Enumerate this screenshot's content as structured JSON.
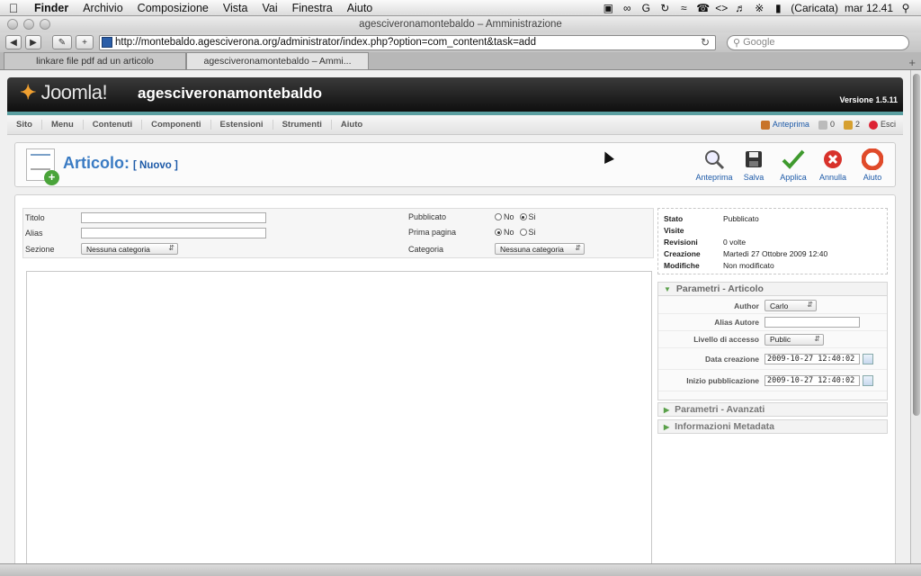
{
  "mac_menubar": {
    "apple": "",
    "items": [
      "Finder",
      "Archivio",
      "Composizione",
      "Vista",
      "Vai",
      "Finestra",
      "Aiuto"
    ],
    "status_icons": [
      "cs-icon",
      "sync-icon",
      "wifi-icon",
      "phone-icon",
      "code-icon",
      "volume-icon",
      "bluetooth-icon"
    ],
    "battery_text": "(Caricata)",
    "clock": "mar 12.41"
  },
  "window": {
    "title": "agesciveronamontebaldo – Amministrazione"
  },
  "browser": {
    "url": "http://montebaldo.agesciverona.org/administrator/index.php?option=com_content&task=add",
    "search_placeholder": "Google",
    "tabs": [
      {
        "label": "linkare file pdf ad un articolo"
      },
      {
        "label": "agesciveronamontebaldo – Ammi..."
      }
    ]
  },
  "joomla": {
    "logo_text": "Joomla!",
    "site_name": "agesciveronamontebaldo",
    "version": "Versione 1.5.11",
    "menu": [
      "Sito",
      "Menu",
      "Contenuti",
      "Componenti",
      "Estensioni",
      "Strumenti",
      "Aiuto"
    ],
    "menu_right": {
      "preview": "Anteprima",
      "messages_count": "0",
      "users_count": "2",
      "logout": "Esci"
    }
  },
  "toolbar": {
    "title": "Articolo:",
    "subtitle": "[ Nuovo ]",
    "buttons": [
      {
        "label": "Anteprima",
        "icon": "preview-icon"
      },
      {
        "label": "Salva",
        "icon": "save-icon"
      },
      {
        "label": "Applica",
        "icon": "apply-icon"
      },
      {
        "label": "Annulla",
        "icon": "cancel-icon"
      },
      {
        "label": "Aiuto",
        "icon": "help-icon"
      }
    ]
  },
  "form": {
    "title_label": "Titolo",
    "title_value": "",
    "alias_label": "Alias",
    "alias_value": "",
    "section_label": "Sezione",
    "section_value": "Nessuna categoria",
    "published_label": "Pubblicato",
    "published_no": "No",
    "published_yes": "Si",
    "published_selected": "Si",
    "frontpage_label": "Prima pagina",
    "frontpage_no": "No",
    "frontpage_yes": "Si",
    "frontpage_selected": "No",
    "category_label": "Categoria",
    "category_value": "Nessuna categoria"
  },
  "info": {
    "rows": [
      {
        "k": "Stato",
        "v": "Pubblicato"
      },
      {
        "k": "Visite",
        "v": ""
      },
      {
        "k": "Revisioni",
        "v": "0 volte"
      },
      {
        "k": "Creazione",
        "v": "Martedì 27 Ottobre 2009 12:40"
      },
      {
        "k": "Modifiche",
        "v": "Non modificato"
      }
    ]
  },
  "params": {
    "head": "Parametri - Articolo",
    "author_label": "Author",
    "author_value": "Carlo",
    "alias_author_label": "Alias Autore",
    "alias_author_value": "",
    "access_label": "Livello di accesso",
    "access_value": "Public",
    "created_label": "Data creazione",
    "created_value": "2009-10-27 12:40:02",
    "publish_up_label": "Inizio pubblicazione",
    "publish_up_value": "2009-10-27 12:40:02"
  },
  "panels": {
    "advanced": "Parametri - Avanzati",
    "metadata": "Informazioni Metadata"
  }
}
